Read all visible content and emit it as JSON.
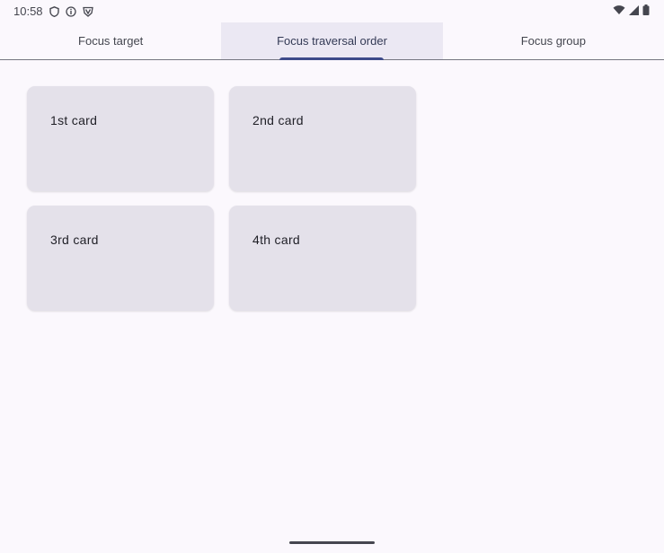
{
  "status_bar": {
    "time": "10:58",
    "left_icons": [
      "shield-icon",
      "info-icon",
      "vpn-icon"
    ],
    "right_icons": [
      "wifi-icon",
      "signal-icon",
      "battery-icon"
    ]
  },
  "tabs": [
    {
      "label": "Focus target",
      "selected": false
    },
    {
      "label": "Focus traversal order",
      "selected": true
    },
    {
      "label": "Focus group",
      "selected": false
    }
  ],
  "cards": [
    {
      "label": "1st card"
    },
    {
      "label": "2nd card"
    },
    {
      "label": "3rd card"
    },
    {
      "label": "4th card"
    }
  ],
  "colors": {
    "background": "#fbf8fd",
    "card": "#e4e1ea",
    "selected_tab": "#ebe8f3",
    "indicator": "#3d4a8a"
  }
}
